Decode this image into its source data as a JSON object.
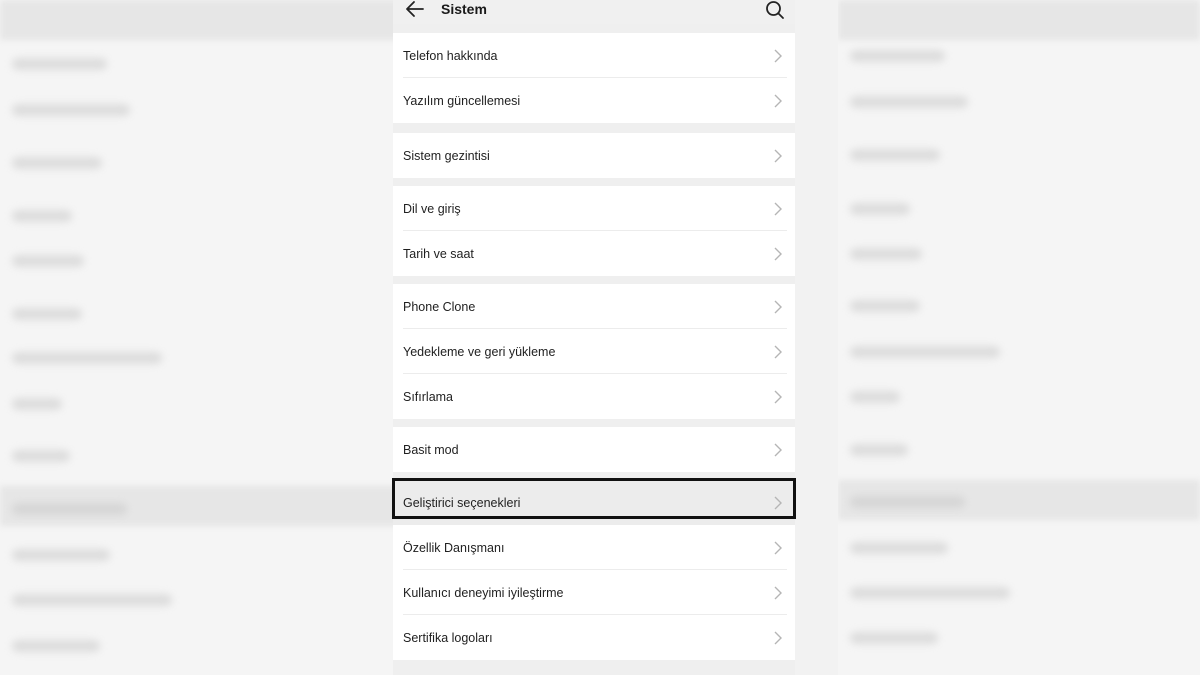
{
  "header": {
    "title": "Sistem",
    "back_icon": "arrow-left-icon",
    "search_icon": "search-icon"
  },
  "groups": [
    {
      "items": [
        "Telefon hakkında",
        "Yazılım güncellemesi"
      ]
    },
    {
      "items": [
        "Sistem gezintisi"
      ]
    },
    {
      "items": [
        "Dil ve giriş",
        "Tarih ve saat"
      ]
    },
    {
      "items": [
        "Phone Clone",
        "Yedekleme ve geri yükleme",
        "Sıfırlama"
      ]
    },
    {
      "items": [
        "Basit mod"
      ]
    },
    {
      "items": [
        "Geliştirici seçenekleri",
        "Özellik Danışmanı",
        "Kullanıcı deneyimi iyileştirme",
        "Sertifika logoları"
      ]
    }
  ],
  "highlighted_item": "Geliştirici seçenekleri",
  "colors": {
    "background": "#efefef",
    "row": "#ffffff",
    "highlight_border": "#111111"
  }
}
